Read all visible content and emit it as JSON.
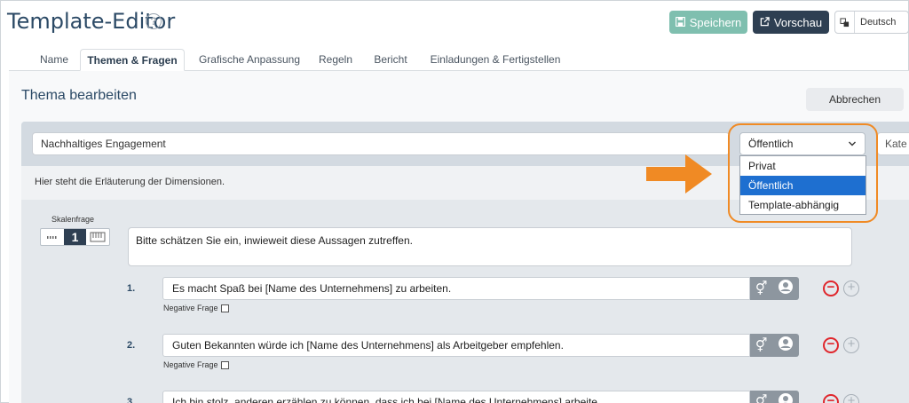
{
  "header": {
    "title": "Template-Editor",
    "help_icon": "?",
    "save_label": "Speichern",
    "preview_label": "Vorschau",
    "language": "Deutsch"
  },
  "tabs": [
    {
      "label": "Name"
    },
    {
      "label": "Themen & Fragen",
      "active": true
    },
    {
      "label": "Grafische Anpassung"
    },
    {
      "label": "Regeln"
    },
    {
      "label": "Bericht"
    },
    {
      "label": "Einladungen & Fertigstellen"
    }
  ],
  "section": {
    "title": "Thema bearbeiten",
    "cancel_label": "Abbrechen"
  },
  "theme": {
    "name": "Nachhaltiges Engagement",
    "visibility": "Öffentlich",
    "category_placeholder": "Kate",
    "description": "Hier steht die Erläuterung der Dimensionen."
  },
  "visibility_dropdown": {
    "options": [
      "Privat",
      "Öffentlich",
      "Template-abhängig"
    ],
    "selected": "Öffentlich"
  },
  "scale_question": {
    "label": "Skalenfrage",
    "selected_icon": "1",
    "intro": "Bitte schätzen Sie ein, inwieweit diese Aussagen zutreffen."
  },
  "questions": [
    {
      "num": "1.",
      "text": "Es macht Spaß bei [Name des Unternehmens] zu arbeiten.",
      "negative_label": "Negative Frage"
    },
    {
      "num": "2.",
      "text": "Guten Bekannten würde ich [Name des Unternehmens] als Arbeitgeber empfehlen.",
      "negative_label": "Negative Frage"
    },
    {
      "num": "3.",
      "text": "Ich bin stolz, anderen erzählen zu können, dass ich bei [Name des Unternehmens] arbeite."
    }
  ],
  "colors": {
    "accent_orange": "#f08a24",
    "save_green": "#7fbfaf",
    "preview_dark": "#2e3f52",
    "selected_blue": "#1e6fd0",
    "remove_red": "#e0262c"
  }
}
